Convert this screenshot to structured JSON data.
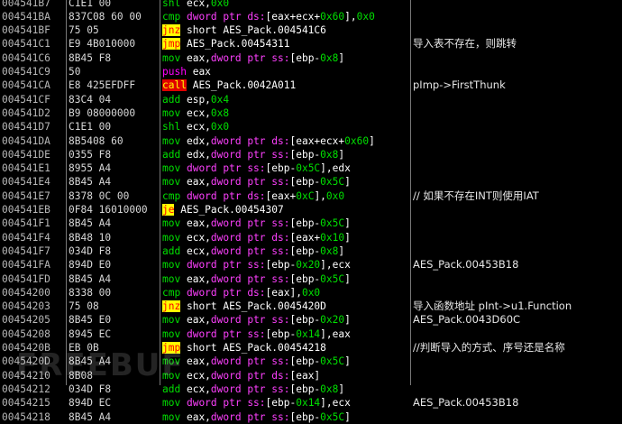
{
  "rows": [
    {
      "addr": "004541B7",
      "hex": "C1E1 00",
      "mn": "shl",
      "mc": "g",
      "ops": [
        [
          "n",
          "ecx,"
        ],
        [
          "g",
          "0x0"
        ]
      ],
      "cmt": ""
    },
    {
      "addr": "004541BA",
      "hex": "837C08 60 00",
      "mn": "cmp",
      "mc": "g",
      "ops": [
        [
          "k",
          "dword ptr ds:"
        ],
        [
          "n",
          "[eax+ecx+"
        ],
        [
          "g",
          "0x60"
        ],
        [
          "n",
          "],"
        ],
        [
          "g",
          "0x0"
        ]
      ],
      "cmt": ""
    },
    {
      "addr": "004541BF",
      "hex": "75 05",
      "mn": "jnz",
      "mc": "y",
      "ops": [
        [
          "n",
          "short AES_Pack.004541C6"
        ]
      ],
      "cmt": ""
    },
    {
      "addr": "004541C1",
      "hex": "E9 4B010000",
      "mn": "jmp",
      "mc": "y",
      "ops": [
        [
          "n",
          "AES_Pack.00454311"
        ]
      ],
      "cmt": "导入表不存在，则跳转"
    },
    {
      "addr": "004541C6",
      "hex": "8B45 F8",
      "mn": "mov",
      "mc": "g",
      "ops": [
        [
          "n",
          "eax,"
        ],
        [
          "k",
          "dword ptr ss:"
        ],
        [
          "n",
          "[ebp-"
        ],
        [
          "g",
          "0x8"
        ],
        [
          "n",
          "]"
        ]
      ],
      "cmt": ""
    },
    {
      "addr": "004541C9",
      "hex": "50",
      "mn": "push",
      "mc": "p",
      "ops": [
        [
          "n",
          "eax"
        ]
      ],
      "cmt": ""
    },
    {
      "addr": "004541CA",
      "hex": "E8 425EFDFF",
      "mn": "call",
      "mc": "r",
      "ops": [
        [
          "n",
          "AES_Pack.0042A011"
        ]
      ],
      "cmt": "pImp->FirstThunk"
    },
    {
      "addr": "004541CF",
      "hex": "83C4 04",
      "mn": "add",
      "mc": "g",
      "ops": [
        [
          "n",
          "esp,"
        ],
        [
          "g",
          "0x4"
        ]
      ],
      "cmt": ""
    },
    {
      "addr": "004541D2",
      "hex": "B9 08000000",
      "mn": "mov",
      "mc": "g",
      "ops": [
        [
          "n",
          "ecx,"
        ],
        [
          "g",
          "0x8"
        ]
      ],
      "cmt": ""
    },
    {
      "addr": "004541D7",
      "hex": "C1E1 00",
      "mn": "shl",
      "mc": "g",
      "ops": [
        [
          "n",
          "ecx,"
        ],
        [
          "g",
          "0x0"
        ]
      ],
      "cmt": ""
    },
    {
      "addr": "004541DA",
      "hex": "8B5408 60",
      "mn": "mov",
      "mc": "g",
      "ops": [
        [
          "n",
          "edx,"
        ],
        [
          "k",
          "dword ptr ds:"
        ],
        [
          "n",
          "[eax+ecx+"
        ],
        [
          "g",
          "0x60"
        ],
        [
          "n",
          "]"
        ]
      ],
      "cmt": ""
    },
    {
      "addr": "004541DE",
      "hex": "0355 F8",
      "mn": "add",
      "mc": "g",
      "ops": [
        [
          "n",
          "edx,"
        ],
        [
          "k",
          "dword ptr ss:"
        ],
        [
          "n",
          "[ebp-"
        ],
        [
          "g",
          "0x8"
        ],
        [
          "n",
          "]"
        ]
      ],
      "cmt": ""
    },
    {
      "addr": "004541E1",
      "hex": "8955 A4",
      "mn": "mov",
      "mc": "g",
      "ops": [
        [
          "k",
          "dword ptr ss:"
        ],
        [
          "n",
          "[ebp-"
        ],
        [
          "g",
          "0x5C"
        ],
        [
          "n",
          "],edx"
        ]
      ],
      "cmt": ""
    },
    {
      "addr": "004541E4",
      "hex": "8B45 A4",
      "mn": "mov",
      "mc": "g",
      "ops": [
        [
          "n",
          "eax,"
        ],
        [
          "k",
          "dword ptr ss:"
        ],
        [
          "n",
          "[ebp-"
        ],
        [
          "g",
          "0x5C"
        ],
        [
          "n",
          "]"
        ]
      ],
      "cmt": ""
    },
    {
      "addr": "004541E7",
      "hex": "8378 0C 00",
      "mn": "cmp",
      "mc": "g",
      "ops": [
        [
          "k",
          "dword ptr ds:"
        ],
        [
          "n",
          "[eax+"
        ],
        [
          "g",
          "0xC"
        ],
        [
          "n",
          "],"
        ],
        [
          "g",
          "0x0"
        ]
      ],
      "cmt": "// 如果不存在INT则使用IAT"
    },
    {
      "addr": "004541EB",
      "hex": "0F84 16010000",
      "mn": "je",
      "mc": "y",
      "ops": [
        [
          "n",
          "AES_Pack.00454307"
        ]
      ],
      "cmt": ""
    },
    {
      "addr": "004541F1",
      "hex": "8B45 A4",
      "mn": "mov",
      "mc": "g",
      "ops": [
        [
          "n",
          "eax,"
        ],
        [
          "k",
          "dword ptr ss:"
        ],
        [
          "n",
          "[ebp-"
        ],
        [
          "g",
          "0x5C"
        ],
        [
          "n",
          "]"
        ]
      ],
      "cmt": ""
    },
    {
      "addr": "004541F4",
      "hex": "8B48 10",
      "mn": "mov",
      "mc": "g",
      "ops": [
        [
          "n",
          "ecx,"
        ],
        [
          "k",
          "dword ptr ds:"
        ],
        [
          "n",
          "[eax+"
        ],
        [
          "g",
          "0x10"
        ],
        [
          "n",
          "]"
        ]
      ],
      "cmt": ""
    },
    {
      "addr": "004541F7",
      "hex": "034D F8",
      "mn": "add",
      "mc": "g",
      "ops": [
        [
          "n",
          "ecx,"
        ],
        [
          "k",
          "dword ptr ss:"
        ],
        [
          "n",
          "[ebp-"
        ],
        [
          "g",
          "0x8"
        ],
        [
          "n",
          "]"
        ]
      ],
      "cmt": ""
    },
    {
      "addr": "004541FA",
      "hex": "894D E0",
      "mn": "mov",
      "mc": "g",
      "ops": [
        [
          "k",
          "dword ptr ss:"
        ],
        [
          "n",
          "[ebp-"
        ],
        [
          "g",
          "0x20"
        ],
        [
          "n",
          "],ecx"
        ]
      ],
      "cmt": "AES_Pack.00453B18"
    },
    {
      "addr": "004541FD",
      "hex": "8B45 A4",
      "mn": "mov",
      "mc": "g",
      "ops": [
        [
          "n",
          "eax,"
        ],
        [
          "k",
          "dword ptr ss:"
        ],
        [
          "n",
          "[ebp-"
        ],
        [
          "g",
          "0x5C"
        ],
        [
          "n",
          "]"
        ]
      ],
      "cmt": ""
    },
    {
      "addr": "00454200",
      "hex": "8338 00",
      "mn": "cmp",
      "mc": "g",
      "ops": [
        [
          "k",
          "dword ptr ds:"
        ],
        [
          "n",
          "[eax],"
        ],
        [
          "g",
          "0x0"
        ]
      ],
      "cmt": ""
    },
    {
      "addr": "00454203",
      "hex": "75 08",
      "mn": "jnz",
      "mc": "y",
      "ops": [
        [
          "n",
          "short AES_Pack.0045420D"
        ]
      ],
      "cmt": "导入函数地址 pInt->u1.Function"
    },
    {
      "addr": "00454205",
      "hex": "8B45 E0",
      "mn": "mov",
      "mc": "g",
      "ops": [
        [
          "n",
          "eax,"
        ],
        [
          "k",
          "dword ptr ss:"
        ],
        [
          "n",
          "[ebp-"
        ],
        [
          "g",
          "0x20"
        ],
        [
          "n",
          "]"
        ]
      ],
      "cmt": "AES_Pack.0043D60C"
    },
    {
      "addr": "00454208",
      "hex": "8945 EC",
      "mn": "mov",
      "mc": "g",
      "ops": [
        [
          "k",
          "dword ptr ss:"
        ],
        [
          "n",
          "[ebp-"
        ],
        [
          "g",
          "0x14"
        ],
        [
          "n",
          "],eax"
        ]
      ],
      "cmt": ""
    },
    {
      "addr": "0045420B",
      "hex": "EB 0B",
      "mn": "jmp",
      "mc": "y",
      "ops": [
        [
          "n",
          "short AES_Pack.00454218"
        ]
      ],
      "cmt": "//判断导入的方式、序号还是名称"
    },
    {
      "addr": "0045420D",
      "hex": "8B45 A4",
      "mn": "mov",
      "mc": "g",
      "ops": [
        [
          "n",
          "eax,"
        ],
        [
          "k",
          "dword ptr ss:"
        ],
        [
          "n",
          "[ebp-"
        ],
        [
          "g",
          "0x5C"
        ],
        [
          "n",
          "]"
        ]
      ],
      "cmt": ""
    },
    {
      "addr": "00454210",
      "hex": "8B08",
      "mn": "mov",
      "mc": "g",
      "ops": [
        [
          "n",
          "ecx,"
        ],
        [
          "k",
          "dword ptr ds:"
        ],
        [
          "n",
          "[eax]"
        ]
      ],
      "cmt": ""
    },
    {
      "addr": "00454212",
      "hex": "034D F8",
      "mn": "add",
      "mc": "g",
      "ops": [
        [
          "n",
          "ecx,"
        ],
        [
          "k",
          "dword ptr ss:"
        ],
        [
          "n",
          "[ebp-"
        ],
        [
          "g",
          "0x8"
        ],
        [
          "n",
          "]"
        ]
      ],
      "cmt": ""
    },
    {
      "addr": "00454215",
      "hex": "894D EC",
      "mn": "mov",
      "mc": "g",
      "ops": [
        [
          "k",
          "dword ptr ss:"
        ],
        [
          "n",
          "[ebp-"
        ],
        [
          "g",
          "0x14"
        ],
        [
          "n",
          "],ecx"
        ]
      ],
      "cmt": "AES_Pack.00453B18"
    },
    {
      "addr": "00454218",
      "hex": "8B45 A4",
      "mn": "mov",
      "mc": "g",
      "ops": [
        [
          "n",
          "eax,"
        ],
        [
          "k",
          "dword ptr ss:"
        ],
        [
          "n",
          "[ebp-"
        ],
        [
          "g",
          "0x5C"
        ],
        [
          "n",
          "]"
        ]
      ],
      "cmt": ""
    }
  ],
  "watermark": "FREEBUF"
}
